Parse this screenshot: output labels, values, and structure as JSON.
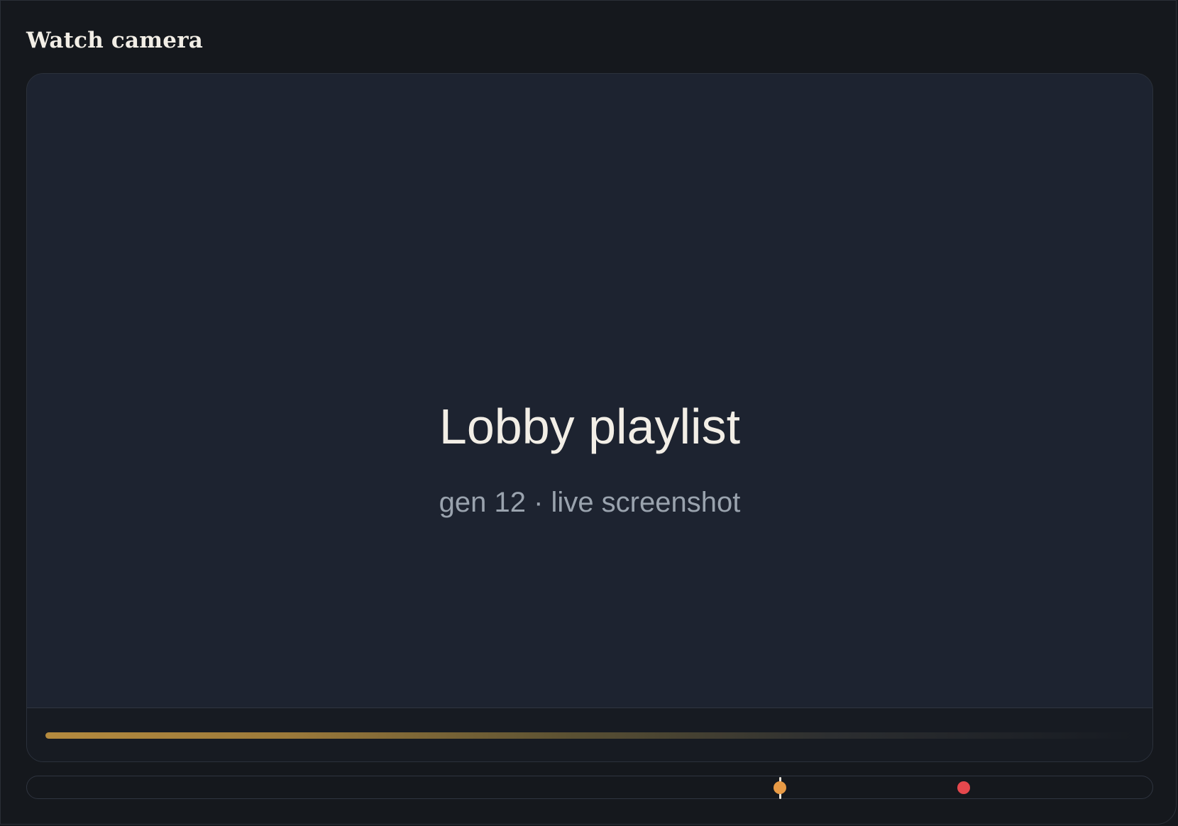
{
  "app": {
    "title": "Watch camera"
  },
  "viewer": {
    "title": "Lobby playlist",
    "subtitle": "gen 12 · live screenshot"
  },
  "timeline": {
    "markers": [
      {
        "name": "current-position-marker",
        "color": "#e89a45"
      },
      {
        "name": "event-marker",
        "color": "#e5484d"
      }
    ]
  },
  "colors": {
    "accent": "#b48a3e",
    "background": "#15181d",
    "panel": "#1d2330",
    "text": "#f2eee6",
    "muted_text": "#9aa3ae"
  }
}
